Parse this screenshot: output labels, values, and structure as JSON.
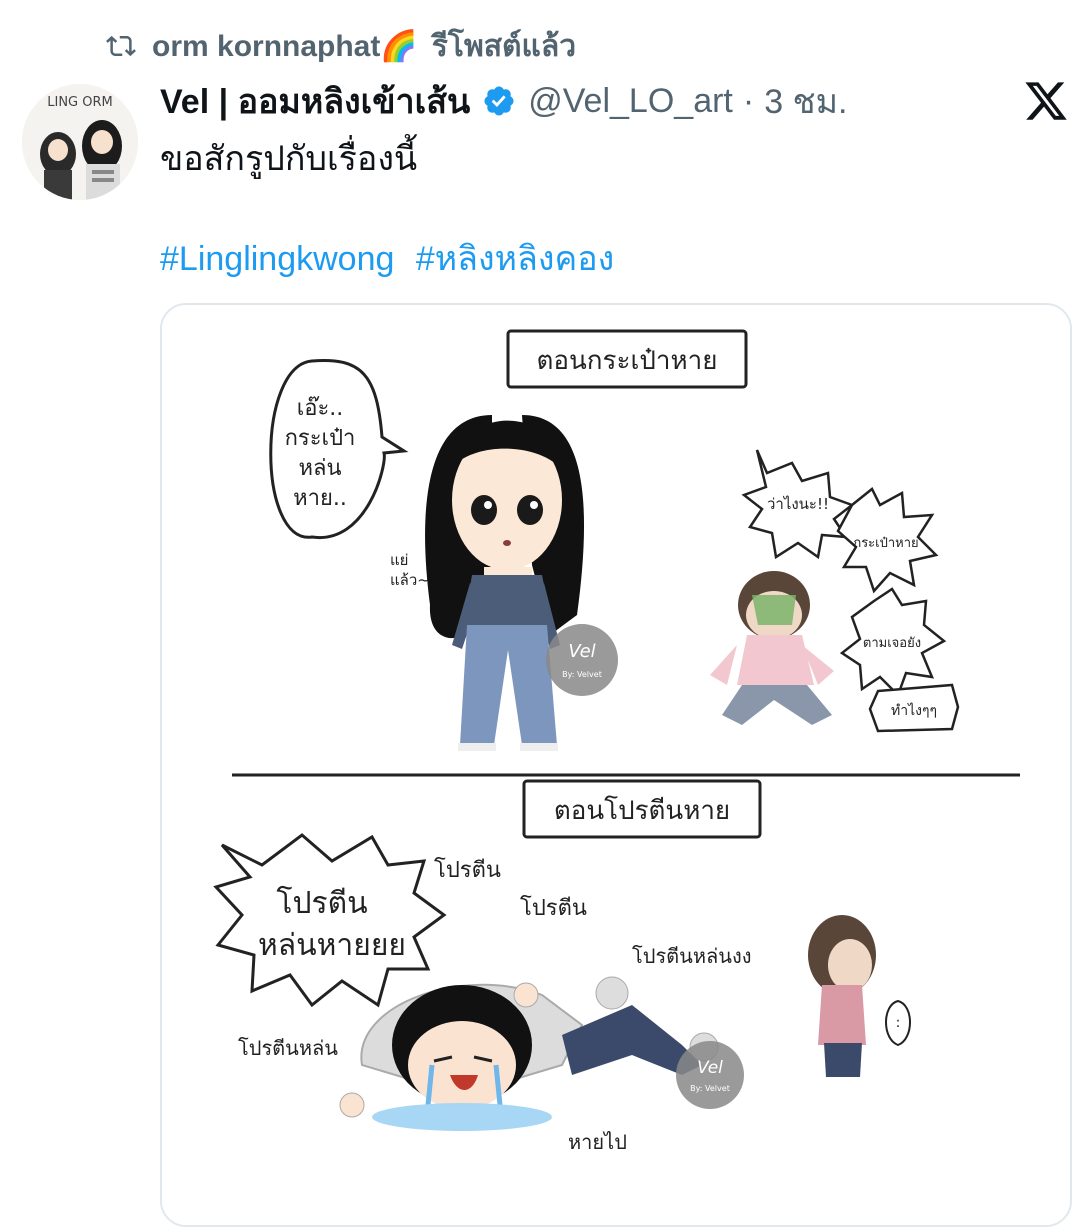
{
  "repost": {
    "icon": "repost-icon",
    "user": "orm kornnaphat🌈",
    "label": "รีโพสต์แล้ว"
  },
  "author": {
    "name": "Vel | ออมหลิงเข้าเส้น",
    "verified": true,
    "handle": "@Vel_LO_art",
    "separator": "·",
    "time": "3 ชม.",
    "avatar_text": "LING ORM"
  },
  "platform_icon": "x-logo-icon",
  "post": {
    "text": "ขอสักรูปกับเรื่องนี้",
    "hashtags": [
      "#Linglingkwong",
      "#หลิงหลิงคอง"
    ]
  },
  "comic": {
    "panel1_title": "ตอนกระเป๋าหาย",
    "panel1_speech": [
      "เอ๊ะ..",
      "กระเป๋า",
      "หล่น",
      "หาย.."
    ],
    "panel1_aside": [
      "แย่",
      "แล้ว~"
    ],
    "panel1_right_bubbles": [
      "ว่าไงนะ!!",
      "กระเป๋าหาย",
      "ตามเจอยัง",
      "ทำไงๆๆ"
    ],
    "panel2_title": "ตอนโปรตีนหาย",
    "panel2_speech": [
      "โปรตีน",
      "หล่นหายยย"
    ],
    "panel2_shouts": [
      "โปรตีน",
      "โปรตีน",
      "โปรตีนหล่นงง",
      "โปรตีนหล่น",
      "หายไป"
    ],
    "watermark": "By: Velvet"
  },
  "colors": {
    "accent": "#1d9bf0",
    "muted": "#536471",
    "text": "#0f1419",
    "verified": "#1d9bf0"
  }
}
